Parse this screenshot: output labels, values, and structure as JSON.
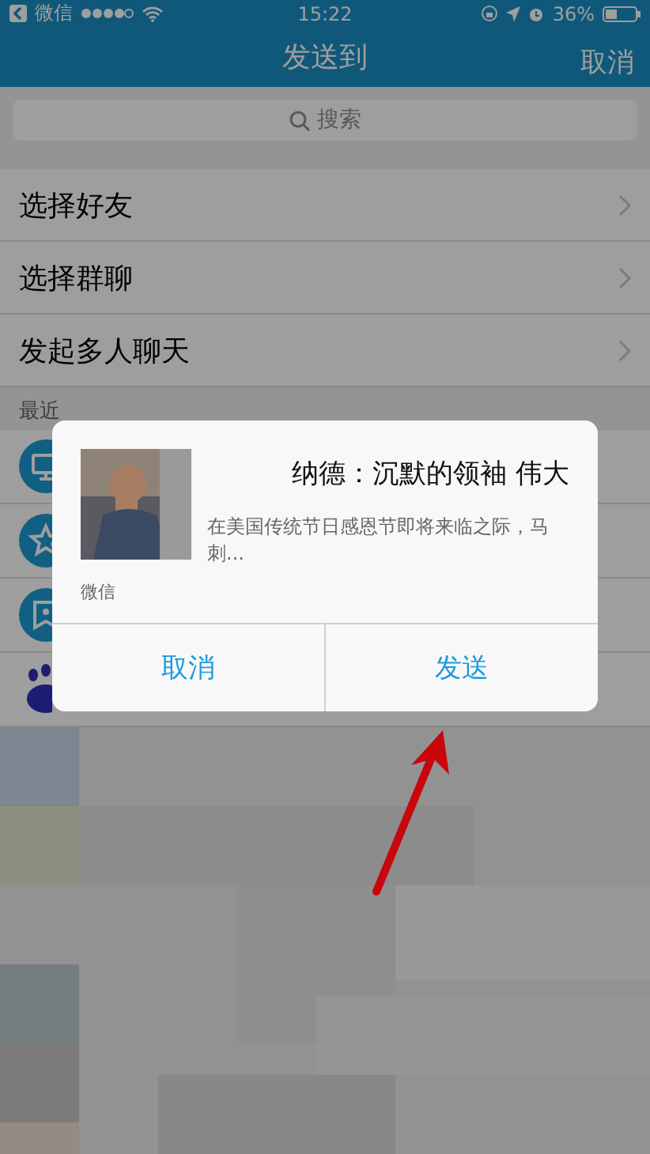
{
  "status_bar": {
    "back_label": "微信",
    "time": "15:22",
    "battery": "36%"
  },
  "nav": {
    "title": "发送到",
    "right_action": "取消"
  },
  "search": {
    "placeholder": "搜索"
  },
  "actions": [
    "选择好友",
    "选择群聊",
    "发起多人聊天"
  ],
  "recent": {
    "header": "最近",
    "items": [
      {
        "kind": "computer"
      },
      {
        "kind": "star"
      },
      {
        "kind": "bookmark"
      },
      {
        "kind": "paw"
      }
    ]
  },
  "dialog": {
    "title": "纳德：沉默的领袖 伟大",
    "description": "在美国传统节日感恩节即将来临之际，马刺...",
    "source": "微信",
    "buttons": [
      "取消",
      "发送"
    ]
  }
}
